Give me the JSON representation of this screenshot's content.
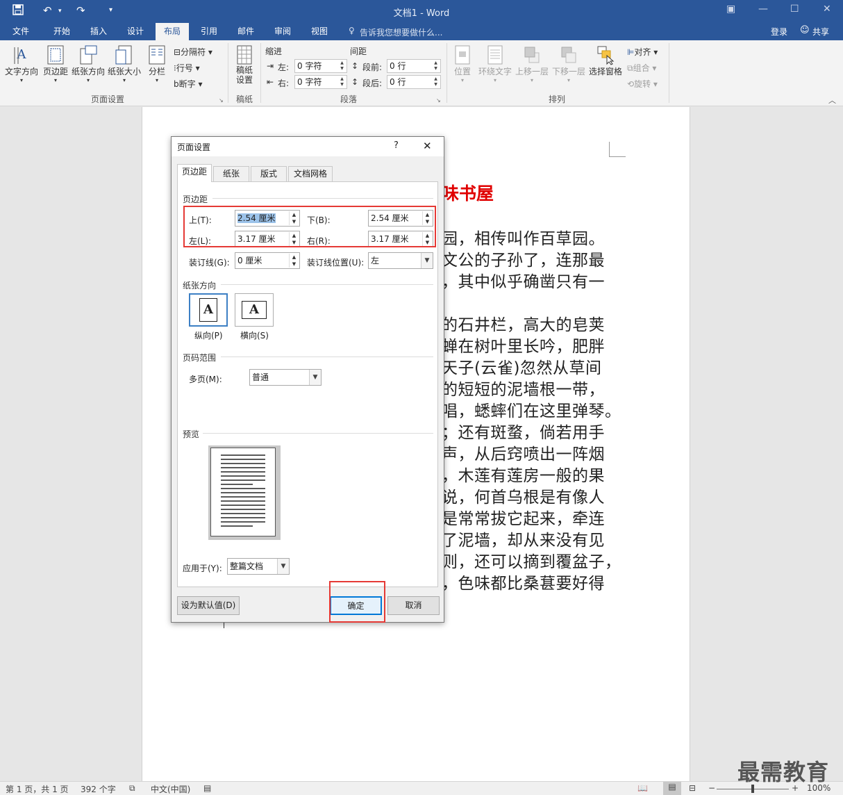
{
  "window": {
    "title": "文档1 - Word"
  },
  "tabs": [
    "文件",
    "开始",
    "插入",
    "设计",
    "布局",
    "引用",
    "邮件",
    "审阅",
    "视图"
  ],
  "tell_me": "告诉我您想要做什么...",
  "account": {
    "login": "登录",
    "share": "共享"
  },
  "ribbon": {
    "page_setup": {
      "text_direction": "文字方向",
      "margins": "页边距",
      "orientation": "纸张方向",
      "size": "纸张大小",
      "columns": "分栏",
      "breaks": "分隔符",
      "line_numbers": "行号",
      "hyphenation": "断字",
      "group": "页面设置"
    },
    "draft": {
      "label": "稿纸\n设置",
      "group": "稿纸"
    },
    "paragraph": {
      "indent": "缩进",
      "spacing": "间距",
      "left_label": "左:",
      "left_value": "0 字符",
      "right_label": "右:",
      "right_value": "0 字符",
      "before_label": "段前:",
      "before_value": "0 行",
      "after_label": "段后:",
      "after_value": "0 行",
      "group": "段落"
    },
    "arrange": {
      "position": "位置",
      "wrap_text": "环绕文字",
      "bring_forward": "上移一层",
      "send_backward": "下移一层",
      "selection_pane": "选择窗格",
      "align": "对齐",
      "group_btn": "组合",
      "rotate": "旋转",
      "group": "排列"
    }
  },
  "document": {
    "title_fragment": "味书屋",
    "lines": [
      "园，相传叫作百草园。",
      "文公的子孙了，连那最",
      "，其中似乎确凿只有一",
      "",
      "的石井栏，高大的皂荚",
      "蝉在树叶里长吟，肥胖",
      "天子(云雀)忽然从草间",
      "的短短的泥墙根一带，",
      "唱，蟋蟀们在这里弹琴。",
      "；还有斑蝥，倘若用手",
      "声，从后窍喷出一阵烟",
      "，木莲有莲房一般的果",
      "说，何首乌根是有像人",
      "是常常拔它起来，牵连",
      "了泥墙，却从来没有见",
      "则，还可以摘到覆盆子，",
      "，色味都比桑葚要好得"
    ]
  },
  "dialog": {
    "title": "页面设置",
    "help": "?",
    "close": "✕",
    "tabs": [
      "页边距",
      "纸张",
      "版式",
      "文档网格"
    ],
    "margins_section": "页边距",
    "top_label": "上(T):",
    "top_value": "2.54 厘米",
    "bottom_label": "下(B):",
    "bottom_value": "2.54 厘米",
    "left_label": "左(L):",
    "left_value": "3.17 厘米",
    "right_label": "右(R):",
    "right_value": "3.17 厘米",
    "gutter_label": "装订线(G):",
    "gutter_value": "0 厘米",
    "gutter_pos_label": "装订线位置(U):",
    "gutter_pos_value": "左",
    "orientation_section": "纸张方向",
    "portrait": "纵向(P)",
    "landscape": "横向(S)",
    "pages_section": "页码范围",
    "multiple_pages_label": "多页(M):",
    "multiple_pages_value": "普通",
    "preview_section": "预览",
    "apply_to_label": "应用于(Y):",
    "apply_to_value": "整篇文档",
    "set_default": "设为默认值(D)",
    "ok": "确定",
    "cancel": "取消"
  },
  "status": {
    "page": "第 1 页，共 1 页",
    "words": "392 个字",
    "language": "中文(中国)",
    "zoom": "100%"
  },
  "watermark": "最需教育"
}
